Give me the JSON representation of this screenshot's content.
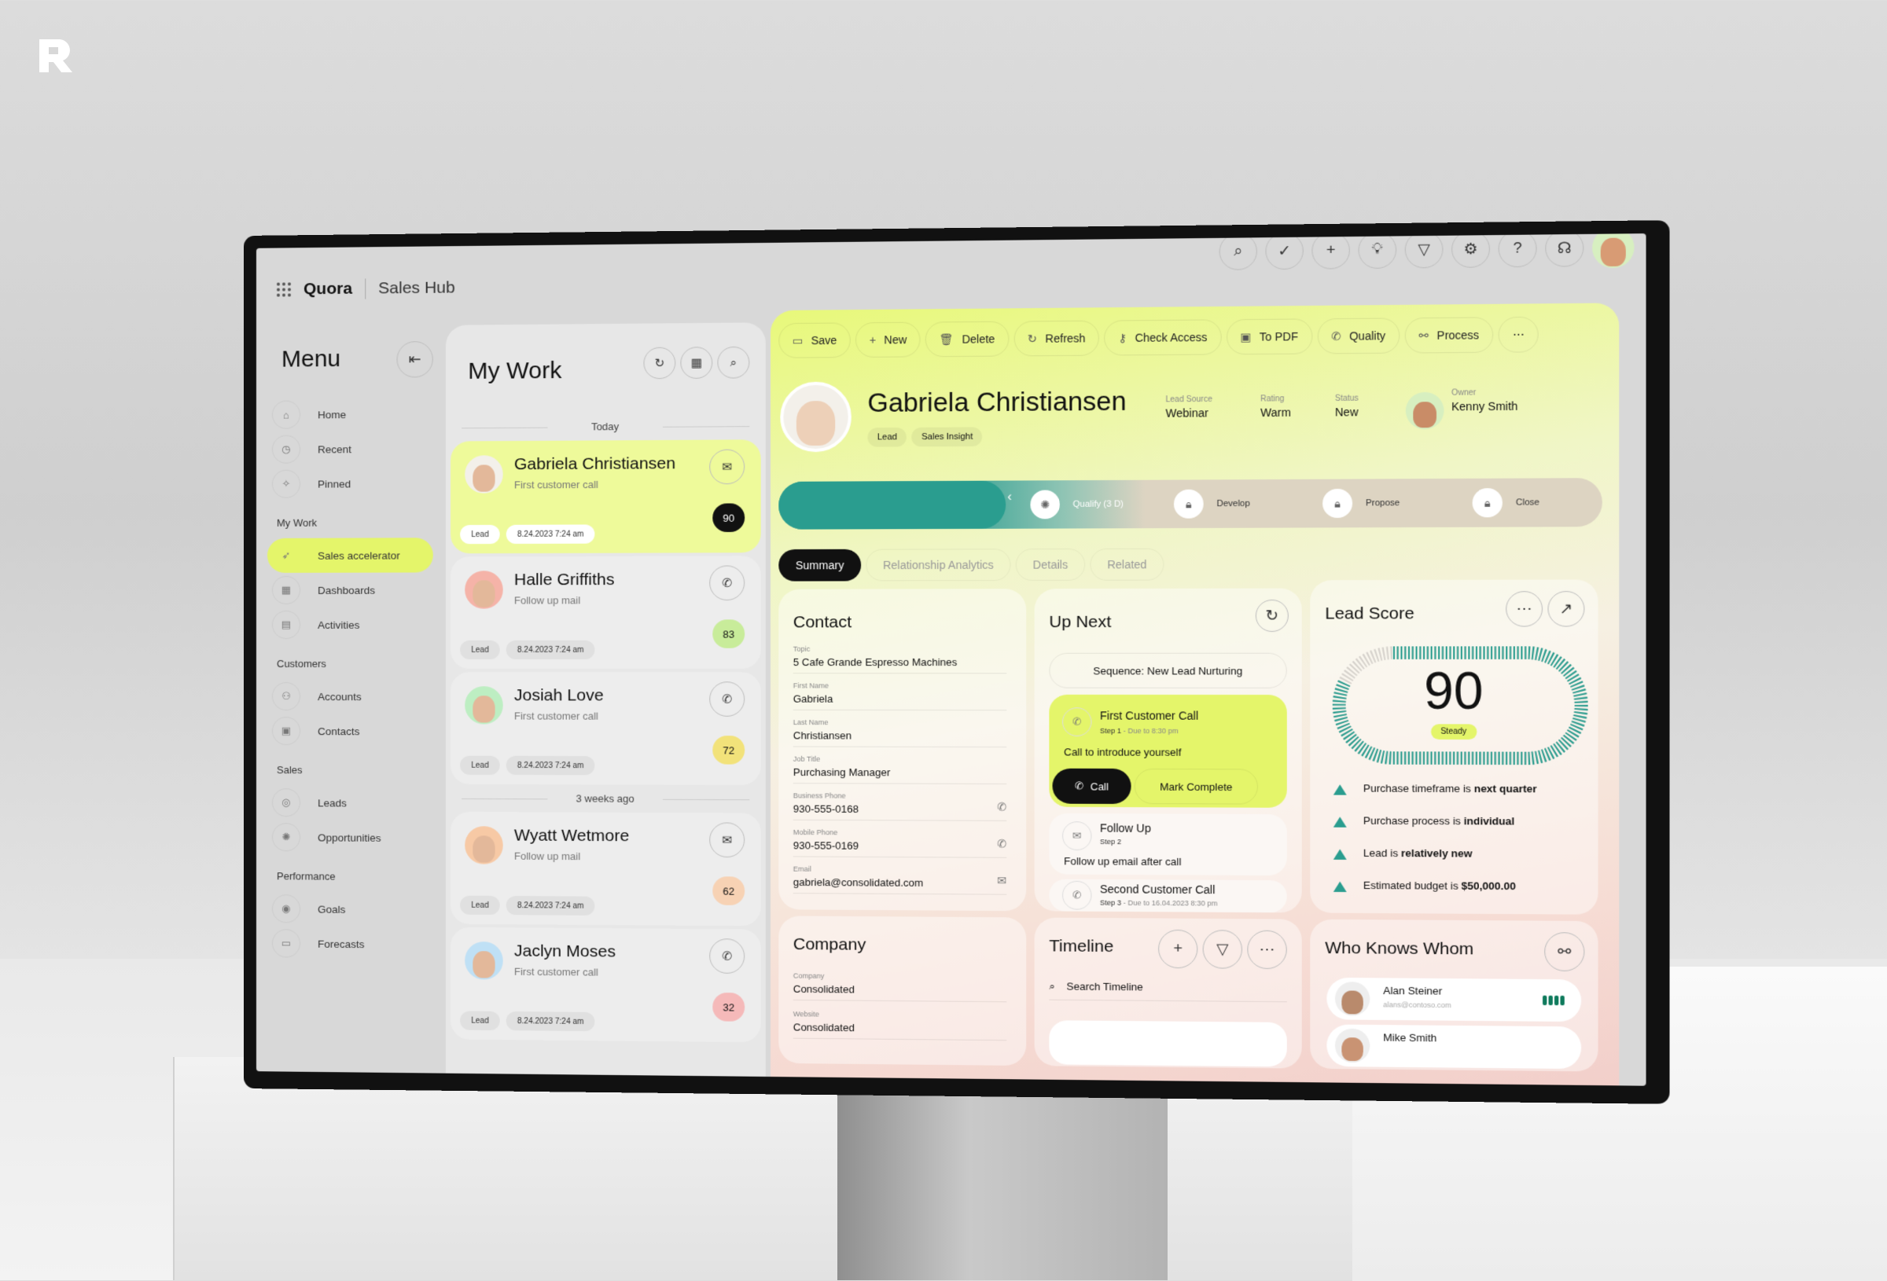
{
  "brand_logo": "R",
  "app": {
    "name": "Quora",
    "hub": "Sales Hub"
  },
  "top_icons": [
    "search-icon",
    "check-circle-icon",
    "plus-icon",
    "lightbulb-icon",
    "filter-icon",
    "gear-icon",
    "help-icon",
    "headset-icon"
  ],
  "sidebar": {
    "title": "Menu",
    "items": [
      {
        "label": "Home",
        "icon": "home-icon",
        "glyph": "⌂"
      },
      {
        "label": "Recent",
        "icon": "clock-icon",
        "glyph": "◷"
      },
      {
        "label": "Pinned",
        "icon": "pin-icon",
        "glyph": "✧"
      }
    ],
    "sections": [
      {
        "title": "My Work",
        "items": [
          {
            "label": "Sales accelerator",
            "glyph": "➶",
            "active": true
          },
          {
            "label": "Dashboards",
            "glyph": "▦"
          },
          {
            "label": "Activities",
            "glyph": "▤"
          }
        ]
      },
      {
        "title": "Customers",
        "items": [
          {
            "label": "Accounts",
            "glyph": "⚇"
          },
          {
            "label": "Contacts",
            "glyph": "▣"
          }
        ]
      },
      {
        "title": "Sales",
        "items": [
          {
            "label": "Leads",
            "glyph": "◎"
          },
          {
            "label": "Opportunities",
            "glyph": "✺"
          }
        ]
      },
      {
        "title": "Performance",
        "items": [
          {
            "label": "Goals",
            "glyph": "◉"
          },
          {
            "label": "Forecasts",
            "glyph": "▭"
          }
        ]
      }
    ]
  },
  "my_work": {
    "title": "My Work",
    "group_today": "Today",
    "group_older": "3 weeks ago",
    "items": [
      {
        "name": "Gabriela Christiansen",
        "sub": "First customer call",
        "tag": "Lead",
        "date": "8.24.2023 7:24 am",
        "score": "90",
        "score_color": "#111111",
        "action": "mail-icon"
      },
      {
        "name": "Halle Griffiths",
        "sub": "Follow up mail",
        "tag": "Lead",
        "date": "8.24.2023 7:24 am",
        "score": "83",
        "score_color": "#c8ec9a",
        "action": "phone-icon"
      },
      {
        "name": "Josiah Love",
        "sub": "First customer call",
        "tag": "Lead",
        "date": "8.24.2023 7:24 am",
        "score": "72",
        "score_color": "#f2e27a",
        "action": "phone-icon"
      },
      {
        "name": "Wyatt Wetmore",
        "sub": "Follow up mail",
        "tag": "Lead",
        "date": "8.24.2023 7:24 am",
        "score": "62",
        "score_color": "#f7d2b4",
        "action": "mail-icon"
      },
      {
        "name": "Jaclyn Moses",
        "sub": "First customer call",
        "tag": "Lead",
        "date": "8.24.2023 7:24 am",
        "score": "32",
        "score_color": "#f5b9b9",
        "action": "phone-icon"
      }
    ]
  },
  "toolbar": [
    "Save",
    "New",
    "Delete",
    "Refresh",
    "Check Access",
    "To PDF",
    "Quality",
    "Process"
  ],
  "record": {
    "name": "Gabriela Christiansen",
    "tags": [
      "Lead",
      "Sales Insight"
    ],
    "lead_source_label": "Lead Source",
    "lead_source": "Webinar",
    "rating_label": "Rating",
    "rating": "Warm",
    "status_label": "Status",
    "status": "New",
    "owner_label": "Owner",
    "owner": "Kenny Smith"
  },
  "stages": [
    {
      "label": "Qualify (3 D)",
      "current": true
    },
    {
      "label": "Develop"
    },
    {
      "label": "Propose"
    },
    {
      "label": "Close"
    }
  ],
  "tabs": [
    "Summary",
    "Relationship Analytics",
    "Details",
    "Related"
  ],
  "contact": {
    "title": "Contact",
    "fields": [
      {
        "label": "Topic",
        "value": "5 Cafe Grande Espresso Machines"
      },
      {
        "label": "First Name",
        "value": "Gabriela"
      },
      {
        "label": "Last Name",
        "value": "Christiansen"
      },
      {
        "label": "Job Title",
        "value": "Purchasing Manager"
      },
      {
        "label": "Business Phone",
        "value": "930-555-0168"
      },
      {
        "label": "Mobile Phone",
        "value": "930-555-0169"
      },
      {
        "label": "Email",
        "value": "gabriela@consolidated.com"
      }
    ]
  },
  "up_next": {
    "title": "Up Next",
    "sequence": "Sequence: New Lead Nurturing",
    "steps": [
      {
        "title": "First Customer Call",
        "step": "Step 1",
        "due": " - Due to 8:30 pm",
        "desc": "Call to introduce yourself"
      },
      {
        "title": "Follow Up",
        "step": "Step 2",
        "due": "",
        "desc": "Follow up email after call"
      },
      {
        "title": "Second Customer Call",
        "step": "Step 3",
        "due": " - Due to 16.04.2023 8:30 pm",
        "desc": ""
      }
    ],
    "call_label": "Call",
    "complete_label": "Mark Complete"
  },
  "lead_score": {
    "title": "Lead Score",
    "score": 90,
    "score_text": "90",
    "trend": "Steady",
    "accent": "#2a9d8f",
    "reasons": [
      {
        "pre": "Purchase timeframe is ",
        "bold": "next quarter"
      },
      {
        "pre": "Purchase process is ",
        "bold": "individual"
      },
      {
        "pre": "Lead is ",
        "bold": "relatively new"
      },
      {
        "pre": "Estimated budget is ",
        "bold": "$50,000.00"
      }
    ]
  },
  "company": {
    "title": "Company",
    "fields": [
      {
        "label": "Company",
        "value": "Consolidated"
      },
      {
        "label": "Website",
        "value": "Consolidated"
      }
    ]
  },
  "timeline": {
    "title": "Timeline",
    "search_placeholder": "Search Timeline"
  },
  "who_knows": {
    "title": "Who Knows Whom",
    "people": [
      {
        "name": "Alan Steiner",
        "email": "alans@contoso.com"
      },
      {
        "name": "Mike Smith",
        "email": ""
      }
    ]
  }
}
